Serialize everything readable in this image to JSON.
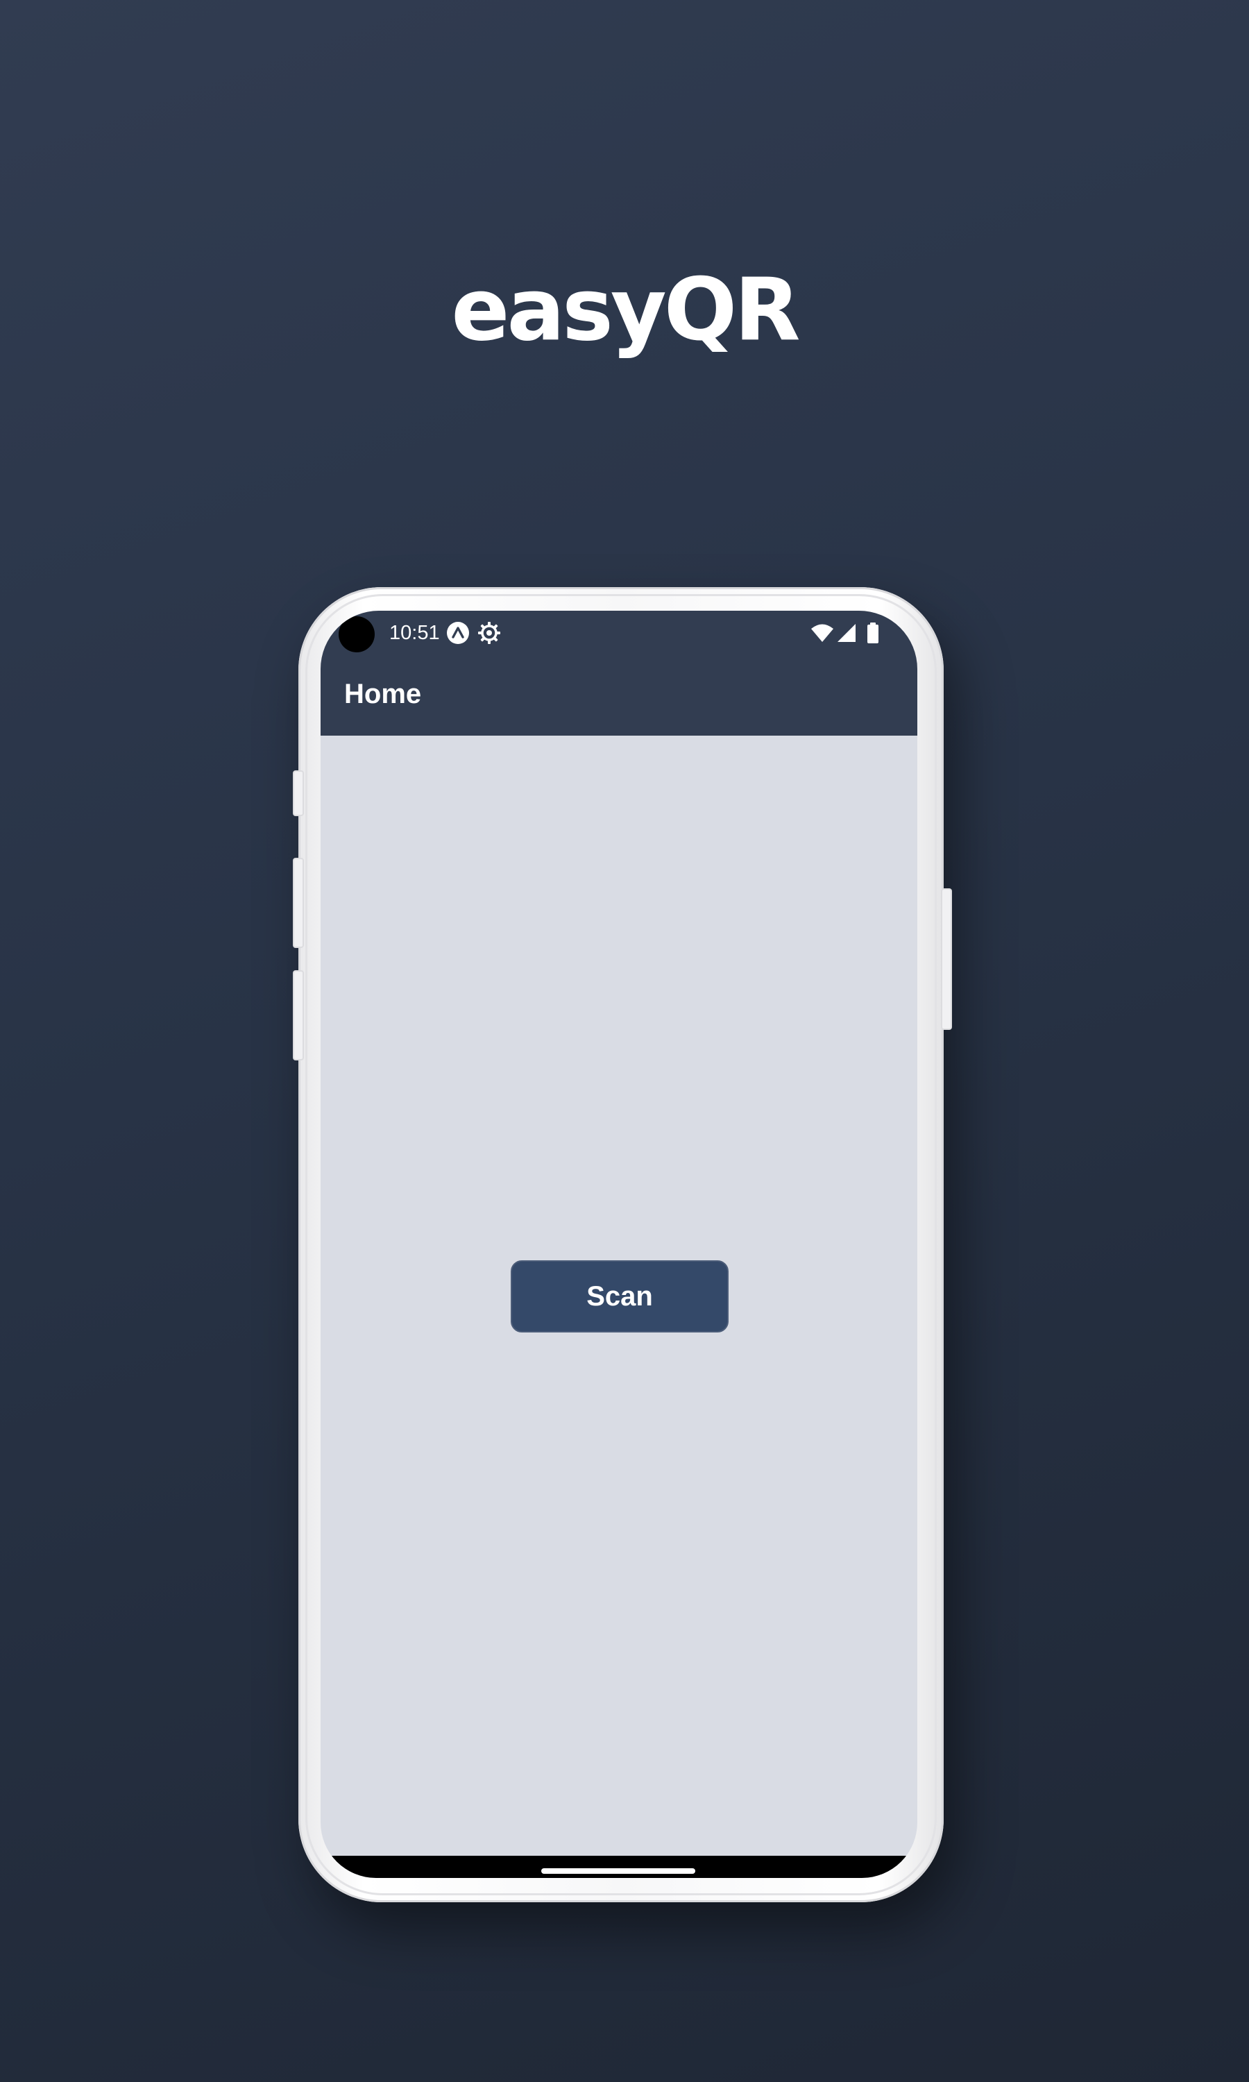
{
  "promo": {
    "title": "easyQR"
  },
  "status_bar": {
    "time": "10:51",
    "icons": [
      "app-notification-icon",
      "settings-gear-icon",
      "wifi-icon",
      "signal-icon",
      "battery-icon"
    ]
  },
  "app_bar": {
    "title": "Home"
  },
  "main": {
    "scan_label": "Scan"
  },
  "colors": {
    "header": "#323d51",
    "content_background": "#d9dce4",
    "button": "#344969",
    "page_background": "#283346"
  }
}
